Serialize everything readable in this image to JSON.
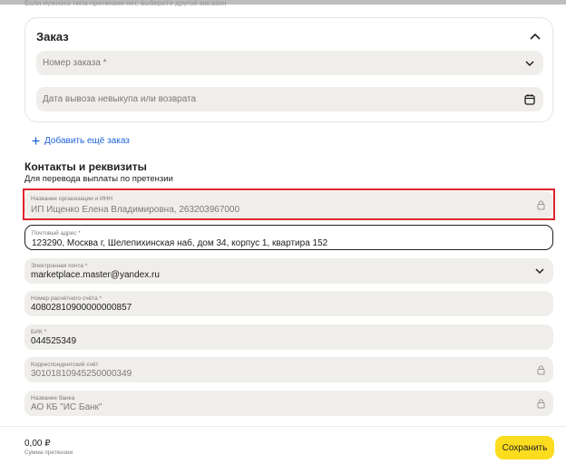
{
  "hint_text": "Если нужного типа претензии нет, выберите другой магазин",
  "order_card": {
    "title": "Заказ",
    "order_number_placeholder": "Номер заказа *",
    "date_placeholder": "Дата вывоза невыкупа или возврата"
  },
  "add_order_label": "Добавить ещё заказ",
  "contacts": {
    "title": "Контакты и реквизиты",
    "subtitle": "Для перевода выплаты по претензии"
  },
  "fields": {
    "org": {
      "label": "Название организации и ИНН",
      "value": "ИП Ищенко Елена Владимировна, 263203967000",
      "icon": "lock-icon"
    },
    "address": {
      "label": "Почтовый адрес *",
      "value": "123290, Москва г, Шелепихинская наб, дом 34, корпус 1, квартира 152"
    },
    "email": {
      "label": "Электронная почта *",
      "value": "marketplace.master@yandex.ru",
      "icon": "chevron-down-icon"
    },
    "account": {
      "label": "Номер расчётного счёта *",
      "value": "40802810900000000857"
    },
    "bik": {
      "label": "БИК *",
      "value": "044525349"
    },
    "corr": {
      "label": "Корреспондентский счёт",
      "value": "30101810945250000349",
      "icon": "lock-icon"
    },
    "bank": {
      "label": "Название банка",
      "value": "АО КБ \"ИС Банк\"",
      "icon": "lock-icon"
    }
  },
  "footer": {
    "sum": "0,00 ₽",
    "sum_caption": "Сумма претензии",
    "save_label": "Сохранить"
  },
  "colors": {
    "accent_button": "#fcdc1f",
    "link": "#1f63d6",
    "highlight_border": "#e0242c",
    "field_bg": "#efeeeb"
  }
}
